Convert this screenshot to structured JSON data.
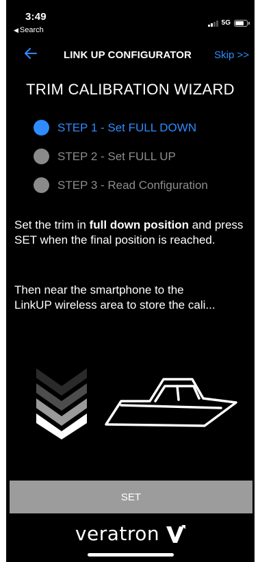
{
  "status_bar": {
    "time": "3:49",
    "back_app": "Search",
    "network": "5G",
    "icons": [
      "signal-icon",
      "battery-icon"
    ]
  },
  "header": {
    "title": "LINK UP CONFIGURATOR",
    "skip_label": "Skip >>",
    "back_icon": "back-arrow-icon"
  },
  "wizard": {
    "title": "TRIM CALIBRATION WIZARD",
    "steps": [
      {
        "label": "STEP 1 - Set FULL DOWN",
        "active": true
      },
      {
        "label": "STEP 2 - Set FULL UP",
        "active": false
      },
      {
        "label": "STEP 3 - Read Configuration",
        "active": false
      }
    ]
  },
  "instructions": {
    "p1_before": "Set the trim in ",
    "p1_bold": "full down position",
    "p1_after": " and press SET when the final position is reached.",
    "p2_line1": "Then near the smartphone to the",
    "p2_line2": "LinkUP wireless area to store the cali..."
  },
  "illustration": {
    "chevrons_icon": "chevrons-down-icon",
    "boat_icon": "boat-icon"
  },
  "actions": {
    "set_label": "SET"
  },
  "brand": {
    "logo_text": "veratron"
  },
  "colors": {
    "background": "#000000",
    "accent": "#2f8cff",
    "inactive": "#8d8d8d",
    "button": "#9c9c9c"
  }
}
